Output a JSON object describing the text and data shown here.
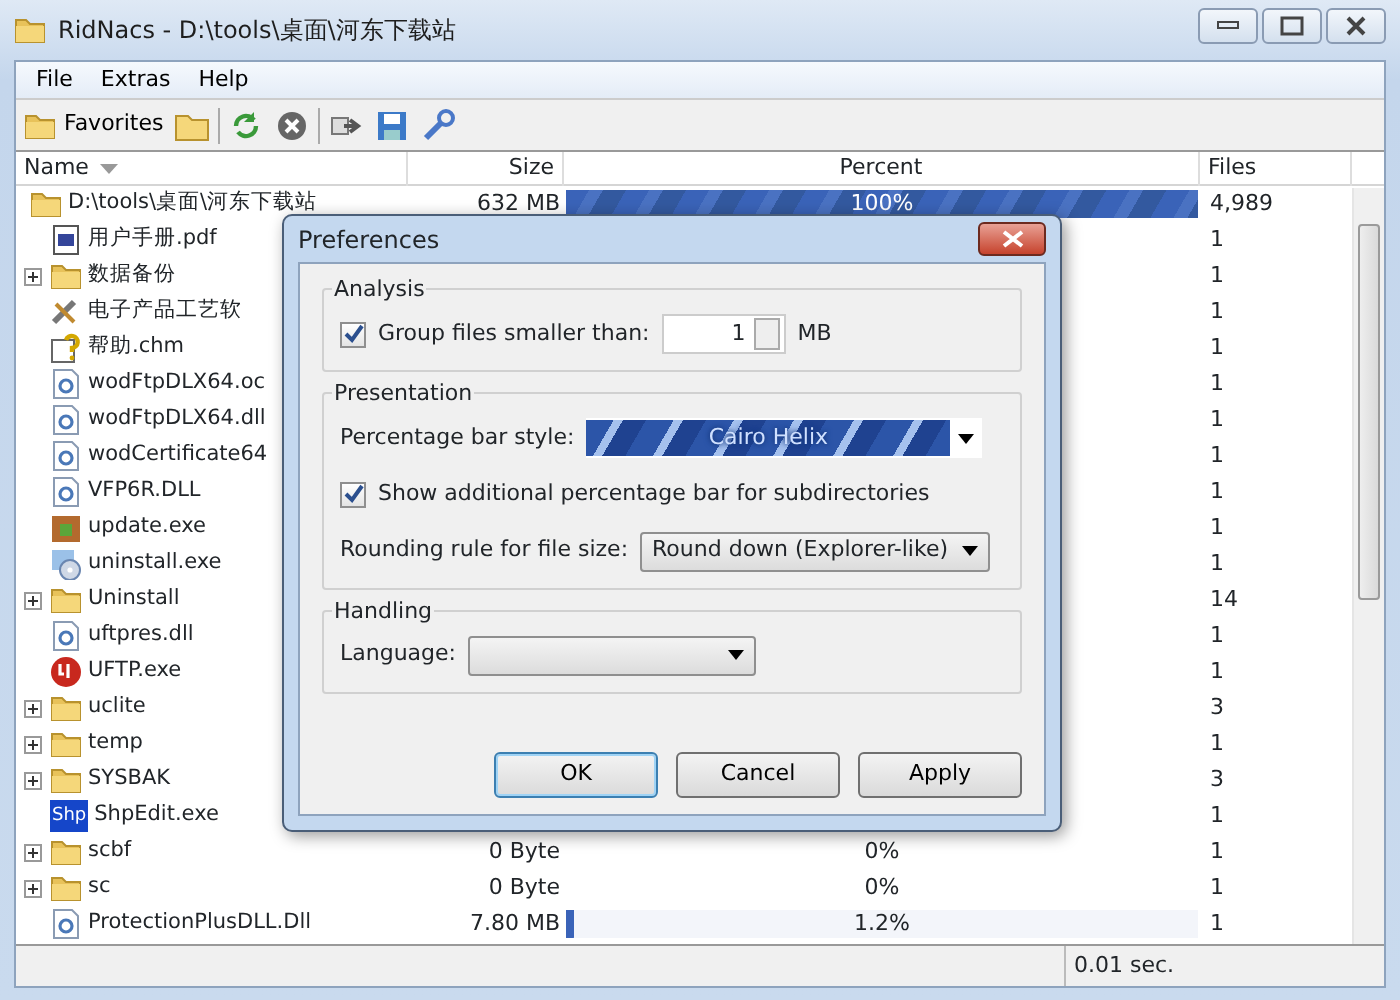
{
  "window": {
    "title": "RidNacs - D:\\tools\\桌面\\河东下载站"
  },
  "menu": [
    "File",
    "Extras",
    "Help"
  ],
  "toolbar": {
    "favorites": "Favorites"
  },
  "table": {
    "columns": [
      "Name",
      "Size",
      "Percent",
      "Files"
    ],
    "rows": [
      {
        "name": "D:\\tools\\桌面\\河东下载站",
        "kind": "folder",
        "expander": false,
        "size": "632 MB",
        "percent": "100%",
        "level": 1,
        "files": "4,989"
      },
      {
        "name": "用户手册.pdf",
        "kind": "pdf",
        "expander": false,
        "files": "1"
      },
      {
        "name": "数据备份",
        "kind": "folder",
        "expander": true,
        "files": "1"
      },
      {
        "name": "电子产品工艺软",
        "kind": "tools",
        "expander": false,
        "files": "1"
      },
      {
        "name": "帮助.chm",
        "kind": "help",
        "expander": false,
        "files": "1"
      },
      {
        "name": "wodFtpDLX64.oc",
        "kind": "dll",
        "expander": false,
        "files": "1"
      },
      {
        "name": "wodFtpDLX64.dll",
        "kind": "dll",
        "expander": false,
        "files": "1"
      },
      {
        "name": "wodCertificate64",
        "kind": "dll",
        "expander": false,
        "files": "1"
      },
      {
        "name": "VFP6R.DLL",
        "kind": "dll",
        "expander": false,
        "files": "1"
      },
      {
        "name": "update.exe",
        "kind": "package",
        "expander": false,
        "files": "1"
      },
      {
        "name": "uninstall.exe",
        "kind": "disc",
        "expander": false,
        "files": "1"
      },
      {
        "name": "Uninstall",
        "kind": "folder",
        "expander": true,
        "files": "14"
      },
      {
        "name": "uftpres.dll",
        "kind": "dll",
        "expander": false,
        "files": "1"
      },
      {
        "name": "UFTP.exe",
        "kind": "badge",
        "expander": false,
        "files": "1"
      },
      {
        "name": "uclite",
        "kind": "folder",
        "expander": true,
        "files": "3"
      },
      {
        "name": "temp",
        "kind": "folder",
        "expander": true,
        "files": "1"
      },
      {
        "name": "SYSBAK",
        "kind": "folder",
        "expander": true,
        "files": "3"
      },
      {
        "name": "ShpEdit.exe",
        "kind": "shp",
        "icon_label": "Shp",
        "expander": false,
        "files": "1"
      },
      {
        "name": "scbf",
        "kind": "folder",
        "expander": true,
        "size": "0 Byte",
        "percent": "0%",
        "files": "1"
      },
      {
        "name": "sc",
        "kind": "folder",
        "expander": true,
        "size": "0 Byte",
        "percent": "0%",
        "files": "1"
      },
      {
        "name": "ProtectionPlusDLL.Dll",
        "kind": "dll",
        "expander": false,
        "size": "7.80 MB",
        "percent": "1.2%",
        "level": 0.012,
        "files": "1"
      }
    ]
  },
  "status_bar": {
    "time": "0.01 sec."
  },
  "dialog": {
    "title": "Preferences",
    "analysis": {
      "heading": "Analysis",
      "group_label": "Group files smaller than:",
      "group_checked": true,
      "group_value": "1",
      "unit": "MB"
    },
    "presentation": {
      "heading": "Presentation",
      "bar_style_label": "Percentage bar style:",
      "bar_style": "Cairo Helix",
      "subdir_label": "Show additional percentage bar for subdirectories",
      "subdir_checked": true,
      "rounding_label": "Rounding rule for file size:",
      "rounding": "Round down (Explorer-like)"
    },
    "handling": {
      "heading": "Handling",
      "language_label": "Language:"
    },
    "buttons": [
      {
        "label": "OK",
        "default": true
      },
      {
        "label": "Cancel",
        "default": false
      },
      {
        "label": "Apply",
        "default": false
      }
    ]
  }
}
